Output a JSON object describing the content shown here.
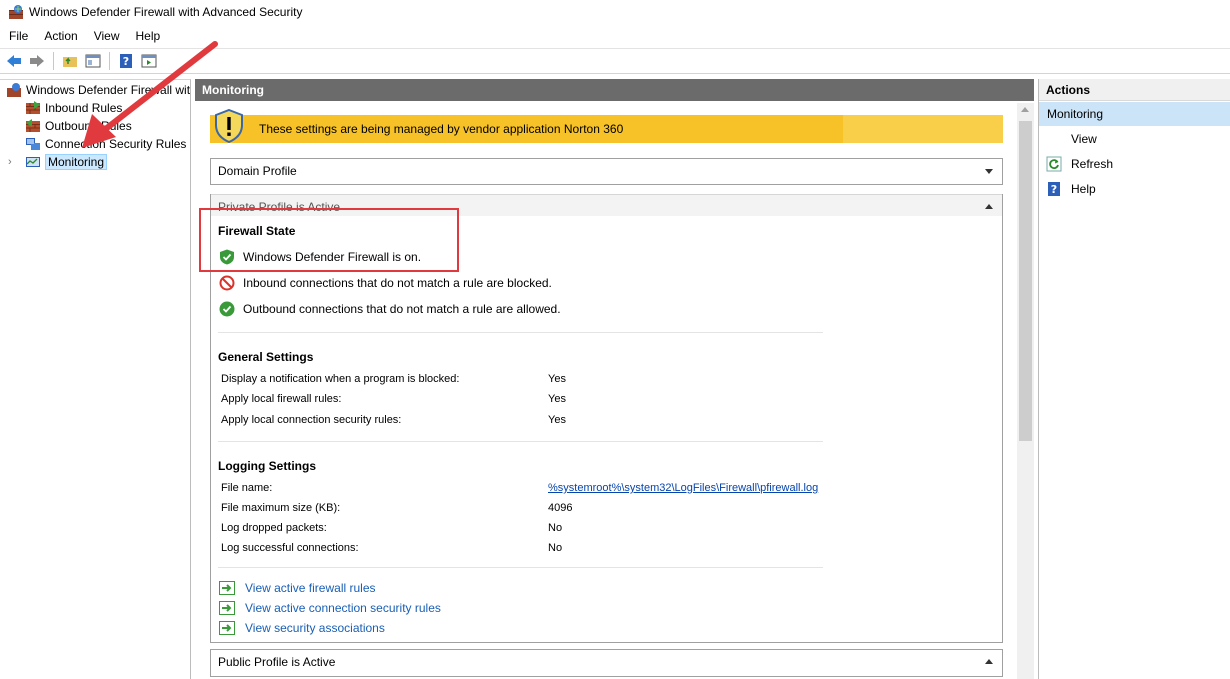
{
  "window": {
    "title": "Windows Defender Firewall with Advanced Security"
  },
  "menu": {
    "items": [
      "File",
      "Action",
      "View",
      "Help"
    ]
  },
  "tree": {
    "root": "Windows Defender Firewall with",
    "items": [
      "Inbound Rules",
      "Outbound Rules",
      "Connection Security Rules",
      "Monitoring"
    ],
    "selected": "Monitoring"
  },
  "center": {
    "header": "Monitoring",
    "banner": "These settings are being managed by vendor application Norton 360",
    "domain_profile": "Domain Profile",
    "private_profile": "Private Profile is Active",
    "public_profile": "Public Profile is Active",
    "firewall_state": {
      "heading": "Firewall State",
      "rows": [
        "Windows Defender Firewall is on.",
        "Inbound connections that do not match a rule are blocked.",
        "Outbound connections that do not match a rule are allowed."
      ]
    },
    "general_settings": {
      "heading": "General Settings",
      "rows": [
        {
          "label": "Display a notification when a program is blocked:",
          "value": "Yes"
        },
        {
          "label": "Apply local firewall rules:",
          "value": "Yes"
        },
        {
          "label": "Apply local connection security rules:",
          "value": "Yes"
        }
      ]
    },
    "logging_settings": {
      "heading": "Logging Settings",
      "rows": [
        {
          "label": "File name:",
          "value": "%systemroot%\\system32\\LogFiles\\Firewall\\pfirewall.log"
        },
        {
          "label": "File maximum size (KB):",
          "value": "4096"
        },
        {
          "label": "Log dropped packets:",
          "value": "No"
        },
        {
          "label": "Log successful connections:",
          "value": "No"
        }
      ]
    },
    "links": [
      "View active firewall rules",
      "View active connection security rules",
      "View security associations"
    ]
  },
  "actions": {
    "header": "Actions",
    "subheader": "Monitoring",
    "items": [
      "View",
      "Refresh",
      "Help"
    ]
  },
  "colors": {
    "banner": "#f7c228",
    "highlight": "#e0393e",
    "link": "#1a5fb4"
  }
}
